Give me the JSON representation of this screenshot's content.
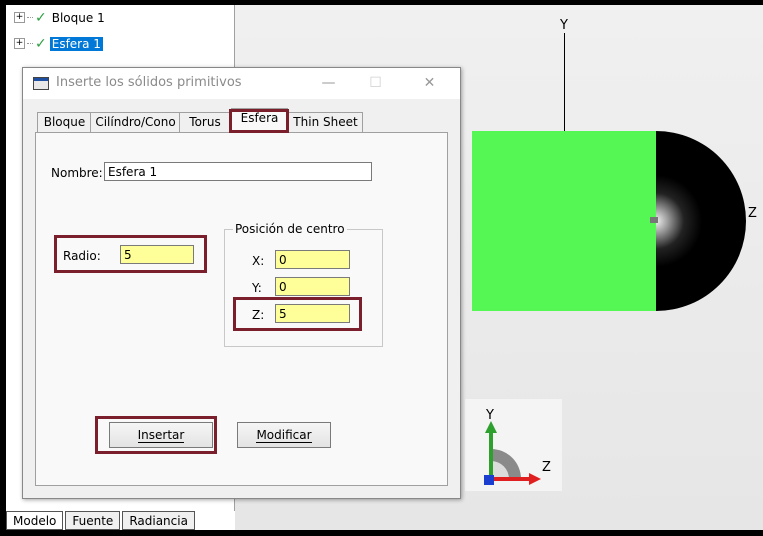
{
  "tree": {
    "items": [
      {
        "label": "Bloque 1",
        "selected": false
      },
      {
        "label": "Esfera 1",
        "selected": true
      }
    ]
  },
  "bottom_tabs": [
    "Modelo",
    "Fuente",
    "Radiancia"
  ],
  "viewport": {
    "y_axis_label": "Y",
    "z_axis_label": "Z",
    "mini_y_label": "Y",
    "mini_z_label": "Z"
  },
  "dialog": {
    "title": "Inserte los sólidos primitivos",
    "minimize_glyph": "—",
    "maximize_glyph": "☐",
    "close_glyph": "✕",
    "tabs": [
      "Bloque",
      "Cilíndro/Cono",
      "Torus",
      "Esfera",
      "Thin Sheet"
    ],
    "active_tab": "Esfera",
    "nombre_label": "Nombre:",
    "nombre_value": "Esfera 1",
    "radio_label": "Radio:",
    "radio_value": "5",
    "group_title": "Posición de centro",
    "x_label": "X:",
    "x_value": "0",
    "y_label": "Y:",
    "y_value": "0",
    "z_label": "Z:",
    "z_value": "5",
    "insert_button": "Insertar",
    "modify_button": "Modificar"
  },
  "colors": {
    "highlight": "#7a1f2b",
    "box_green": "#55f755",
    "field_yellow": "#ffff99",
    "selection_blue": "#0078d7"
  }
}
